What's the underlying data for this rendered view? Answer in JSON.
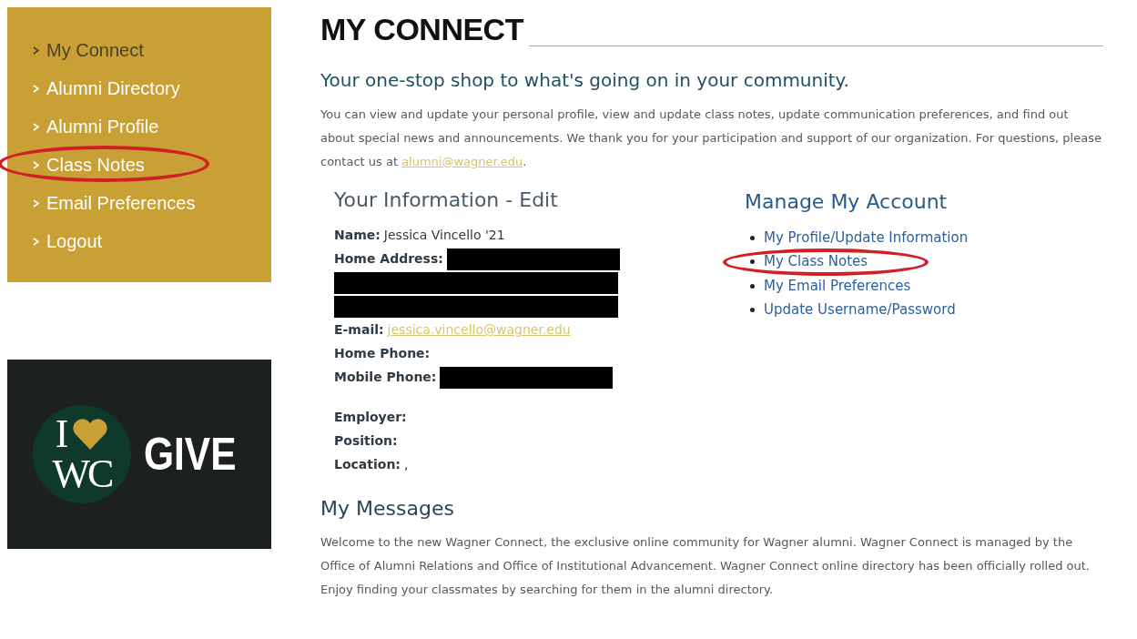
{
  "sidebar": {
    "items": [
      {
        "label": "My Connect",
        "selected": true,
        "highlighted": false
      },
      {
        "label": "Alumni Directory",
        "selected": false,
        "highlighted": false
      },
      {
        "label": "Alumni Profile",
        "selected": false,
        "highlighted": false
      },
      {
        "label": "Class Notes",
        "selected": false,
        "highlighted": true
      },
      {
        "label": "Email Preferences",
        "selected": false,
        "highlighted": false
      },
      {
        "label": "Logout",
        "selected": false,
        "highlighted": false
      }
    ]
  },
  "give_banner": {
    "logo_top": "I",
    "logo_bottom": "WC",
    "label": "GIVE"
  },
  "page_title": "MY CONNECT",
  "subtitle": "Your one-stop shop to what's going on in your community.",
  "intro": {
    "text": "You can view and update your personal profile, view and update class notes, update communication preferences, and find out about special news and announcements. We thank you for your participation and support of our organization. For questions, please contact us at ",
    "email": "alumni@wagner.edu",
    "end": "."
  },
  "your_information": {
    "heading": "Your Information - Edit",
    "fields": [
      {
        "kind": "text",
        "label": "Name:",
        "value": "Jessica Vincello '21"
      },
      {
        "kind": "redacted",
        "label": "Home Address:"
      },
      {
        "kind": "redacted_line"
      },
      {
        "kind": "redacted_line"
      },
      {
        "kind": "link",
        "label": "E-mail:",
        "value": "jessica.vincello@wagner.edu"
      },
      {
        "kind": "text",
        "label": "Home Phone:"
      },
      {
        "kind": "redacted",
        "label": "Mobile Phone:"
      },
      {
        "kind": "gap"
      },
      {
        "kind": "text",
        "label": "Employer:"
      },
      {
        "kind": "text",
        "label": "Position:"
      },
      {
        "kind": "text",
        "label": "Location:",
        "value": ","
      }
    ]
  },
  "manage_account": {
    "heading": "Manage My Account",
    "links": [
      {
        "label": "My Profile/Update Information",
        "highlighted": false
      },
      {
        "label": "My Class Notes",
        "highlighted": true
      },
      {
        "label": "My Email Preferences",
        "highlighted": false
      },
      {
        "label": "Update Username/Password",
        "highlighted": false
      }
    ]
  },
  "messages": {
    "heading": "My Messages",
    "text": "Welcome to the new Wagner Connect, the exclusive online community for Wagner alumni. Wagner Connect is managed by the Office of Alumni Relations and Office of Institutional Advancement. Wagner Connect online directory has been officially rolled out. Enjoy finding your classmates by searching for them in the alumni directory."
  }
}
